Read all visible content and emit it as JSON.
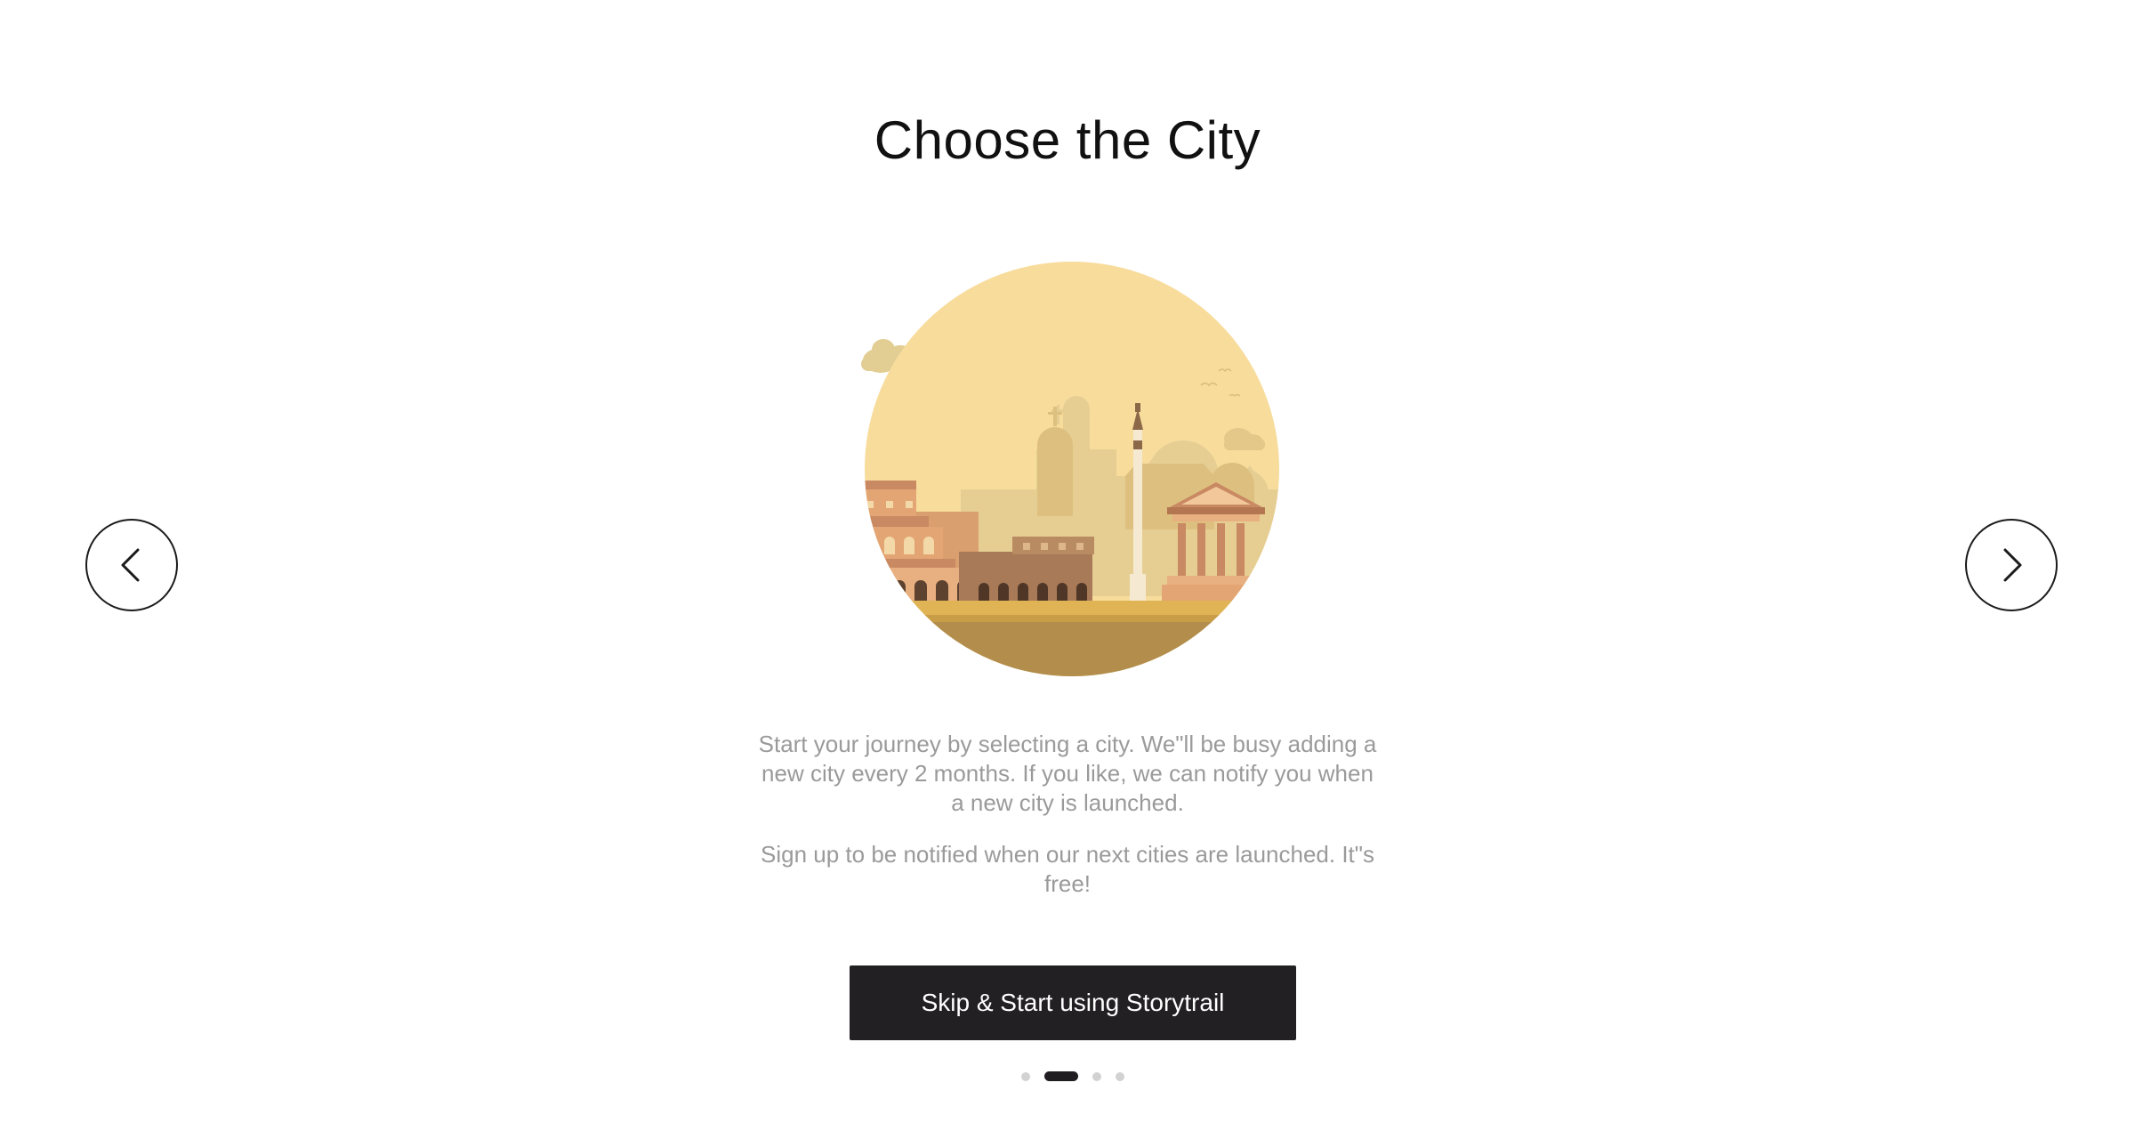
{
  "page": {
    "title": "Choose the City"
  },
  "navigation": {
    "prev_icon": "chevron-left-icon",
    "next_icon": "chevron-right-icon"
  },
  "illustration": {
    "subject": "city-skyline-icon",
    "colors": {
      "sky": "#F7DC9C",
      "ground": "#B28D4B",
      "road": "#E0B455",
      "silhouette": "#E4C88A",
      "colosseum": "#E2A573",
      "temple": "#C98962",
      "column": "#8B6848"
    }
  },
  "description": {
    "paragraph1": "Start your journey by selecting a city. We\"ll be busy adding a new city every 2 months. If you like, we can notify you when a new city is launched.",
    "paragraph2": "Sign up to be notified when our next cities are launched. It\"s free!"
  },
  "cta": {
    "label": "Skip & Start using Storytrail"
  },
  "pagination": {
    "total": 4,
    "active_index": 1
  },
  "colors": {
    "button_bg": "#222022",
    "text_muted": "#9A9A9A",
    "dot_inactive": "#D2D2D2",
    "dot_active": "#1F1D1F"
  }
}
